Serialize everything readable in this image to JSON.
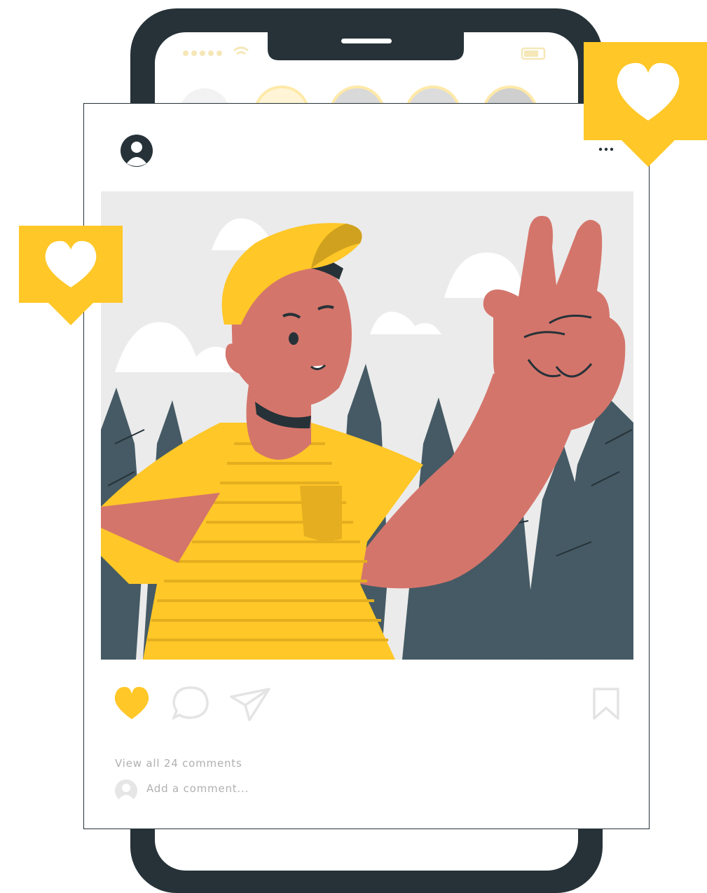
{
  "post": {
    "view_comments": "View all 24 comments",
    "add_comment_placeholder": "Add a comment..."
  },
  "colors": {
    "phone_frame": "#263238",
    "accent_yellow": "#FFC727",
    "skin": "#D4756B",
    "tree": "#455A64",
    "sky": "#EBEBEB"
  },
  "icons": {
    "like": "heart-icon",
    "comment": "speech-bubble-icon",
    "share": "paper-plane-icon",
    "save": "bookmark-icon",
    "more": "more-options-icon",
    "notification": "heart-notification-icon"
  }
}
